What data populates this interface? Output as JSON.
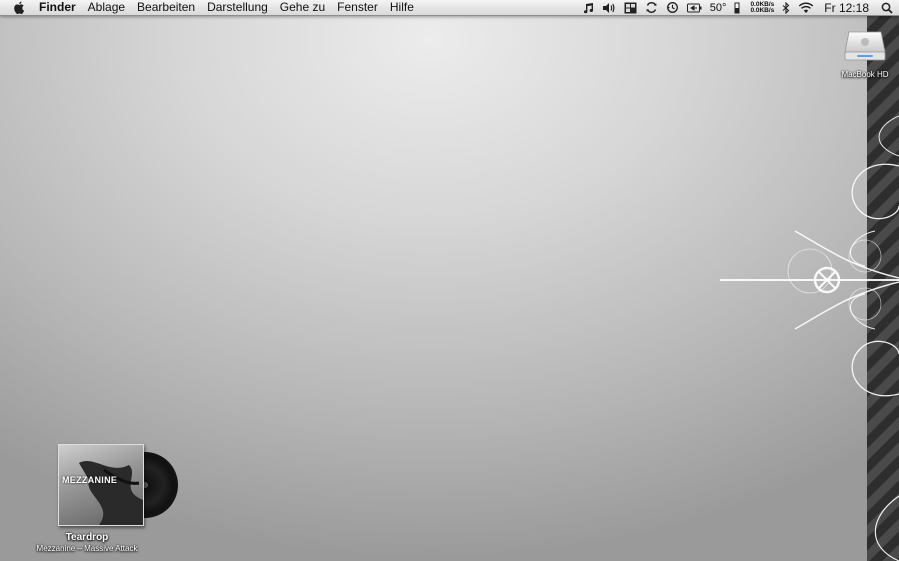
{
  "menubar": {
    "apple_icon": "apple-logo",
    "app_name": "Finder",
    "items": [
      "Ablage",
      "Bearbeiten",
      "Darstellung",
      "Gehe zu",
      "Fenster",
      "Hilfe"
    ],
    "status": {
      "icons": [
        "music-note-icon",
        "volume-icon",
        "menu-meters-icon",
        "sync-icon",
        "time-machine-icon",
        "battery-icon",
        "temperature-icon",
        "bluetooth-icon",
        "wifi-icon",
        "spotlight-icon"
      ],
      "temperature": "50°",
      "net_up": "0.0KB/s",
      "net_down": "0.0KB/s",
      "clock": "Fr 12:18"
    }
  },
  "desktop": {
    "hd_label": "MacBook HD",
    "album": {
      "cover_text": "MEZZANINE",
      "track": "Teardrop",
      "subtitle": "Mezzanine – Massive Attack"
    }
  }
}
